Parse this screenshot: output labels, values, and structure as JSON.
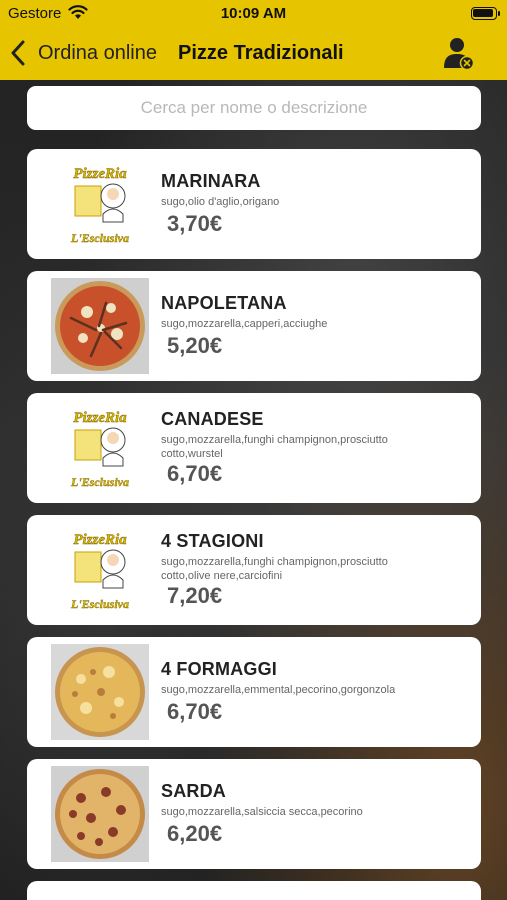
{
  "status": {
    "carrier": "Gestore",
    "time": "10:09 AM"
  },
  "nav": {
    "back_label": "Ordina online",
    "title": "Pizze Tradizionali",
    "right_icon": "user-cancel-icon"
  },
  "search": {
    "placeholder": "Cerca per nome o descrizione",
    "value": ""
  },
  "colors": {
    "header": "#e6c400",
    "card": "#ffffff",
    "price": "#555555"
  },
  "products": [
    {
      "name": "MARINARA",
      "description": "sugo,olio d'aglio,origano",
      "price": "3,70€",
      "image": "logo"
    },
    {
      "name": "NAPOLETANA",
      "description": "sugo,mozzarella,capperi,acciughe",
      "price": "5,20€",
      "image": "pizza"
    },
    {
      "name": "CANADESE",
      "description": "sugo,mozzarella,funghi champignon,prosciutto cotto,wurstel",
      "price": "6,70€",
      "image": "logo"
    },
    {
      "name": "4 STAGIONI",
      "description": "sugo,mozzarella,funghi champignon,prosciutto cotto,olive nere,carciofini",
      "price": "7,20€",
      "image": "logo"
    },
    {
      "name": "4 FORMAGGI",
      "description": "sugo,mozzarella,emmental,pecorino,gorgonzola",
      "price": "6,70€",
      "image": "pizza"
    },
    {
      "name": "SARDA",
      "description": "sugo,mozzarella,salsiccia secca,pecorino",
      "price": "6,20€",
      "image": "pizza"
    }
  ]
}
